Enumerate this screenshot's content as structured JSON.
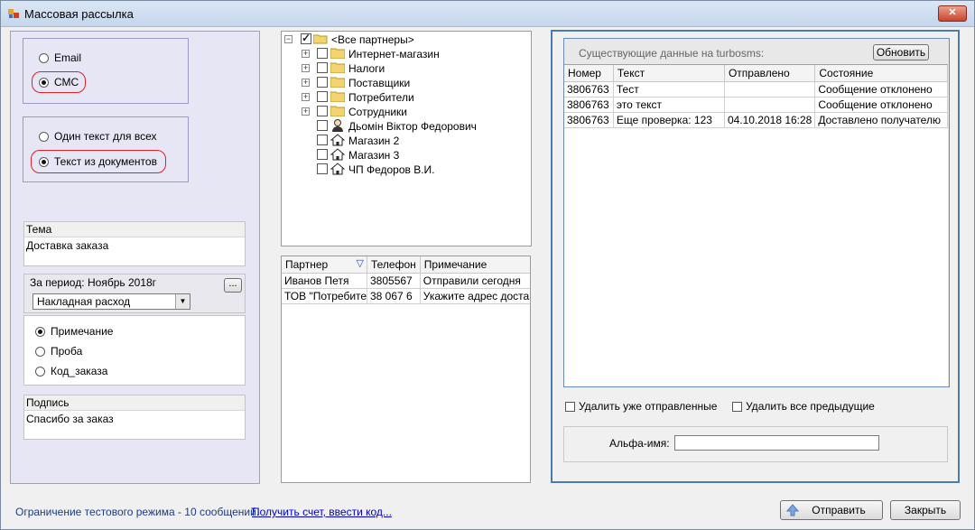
{
  "window": {
    "title": "Массовая рассылка",
    "close_glyph": "✕"
  },
  "channel": {
    "email": "Email",
    "sms": "СМС",
    "selected": "sms"
  },
  "text_mode": {
    "one_text": "Один текст для всех",
    "from_docs": "Текст из документов",
    "selected": "from_docs"
  },
  "subject": {
    "label": "Тема",
    "value": "Доставка заказа"
  },
  "period": {
    "label": "За период:",
    "value": "Ноябрь 2018г",
    "browse": "...",
    "doc_type": "Накладная расход"
  },
  "fields": {
    "items": [
      "Примечание",
      "Проба",
      "Код_заказа"
    ],
    "selected": 0
  },
  "signature": {
    "label": "Подпись",
    "value": "Спасибо за заказ"
  },
  "tree": {
    "root": "<Все партнеры>",
    "items": [
      {
        "label": "Интернет-магазин",
        "type": "folder"
      },
      {
        "label": "Налоги",
        "type": "folder"
      },
      {
        "label": "Поставщики",
        "type": "folder"
      },
      {
        "label": "Потребители",
        "type": "folder"
      },
      {
        "label": "Сотрудники",
        "type": "folder"
      },
      {
        "label": "Дьомін Віктор Федорович",
        "type": "person"
      },
      {
        "label": "Магазин 2",
        "type": "house"
      },
      {
        "label": "Магазин 3",
        "type": "house"
      },
      {
        "label": "ЧП Федоров В.И.",
        "type": "house"
      }
    ]
  },
  "partners": {
    "headers": [
      "Партнер",
      "Телефон",
      "Примечание"
    ],
    "rows": [
      [
        "Иванов Петя",
        "3805567",
        "Отправили сегодня"
      ],
      [
        "ТОВ \"Потребите",
        "38 067 6",
        "Укажите адрес достав"
      ]
    ]
  },
  "turbosms": {
    "caption": "Существующие данные на turbosms:",
    "refresh": "Обновить",
    "headers": [
      "Номер",
      "Текст",
      "Отправлено",
      "Состояние"
    ],
    "rows": [
      [
        "3806763",
        "Тест",
        "",
        "Сообщение отклонено"
      ],
      [
        "3806763",
        "это текст",
        "",
        "Сообщение отклонено"
      ],
      [
        "3806763",
        "Еще проверка:  123",
        "04.10.2018 16:28",
        "Доставлено получателю"
      ]
    ]
  },
  "options": {
    "delete_sent": "Удалить уже отправленные",
    "delete_prev": "Удалить все предыдущие"
  },
  "alpha": {
    "label": "Альфа-имя:",
    "value": ""
  },
  "footer": {
    "limit": "Ограничение тестового режима - 10 сообщений.",
    "link": "Получить счет, ввести код...",
    "send": "Отправить",
    "close": "Закрыть"
  },
  "colors": {
    "link": "#0000cc",
    "info": "#1a3a8a",
    "accent_border": "#4a7ab0"
  }
}
